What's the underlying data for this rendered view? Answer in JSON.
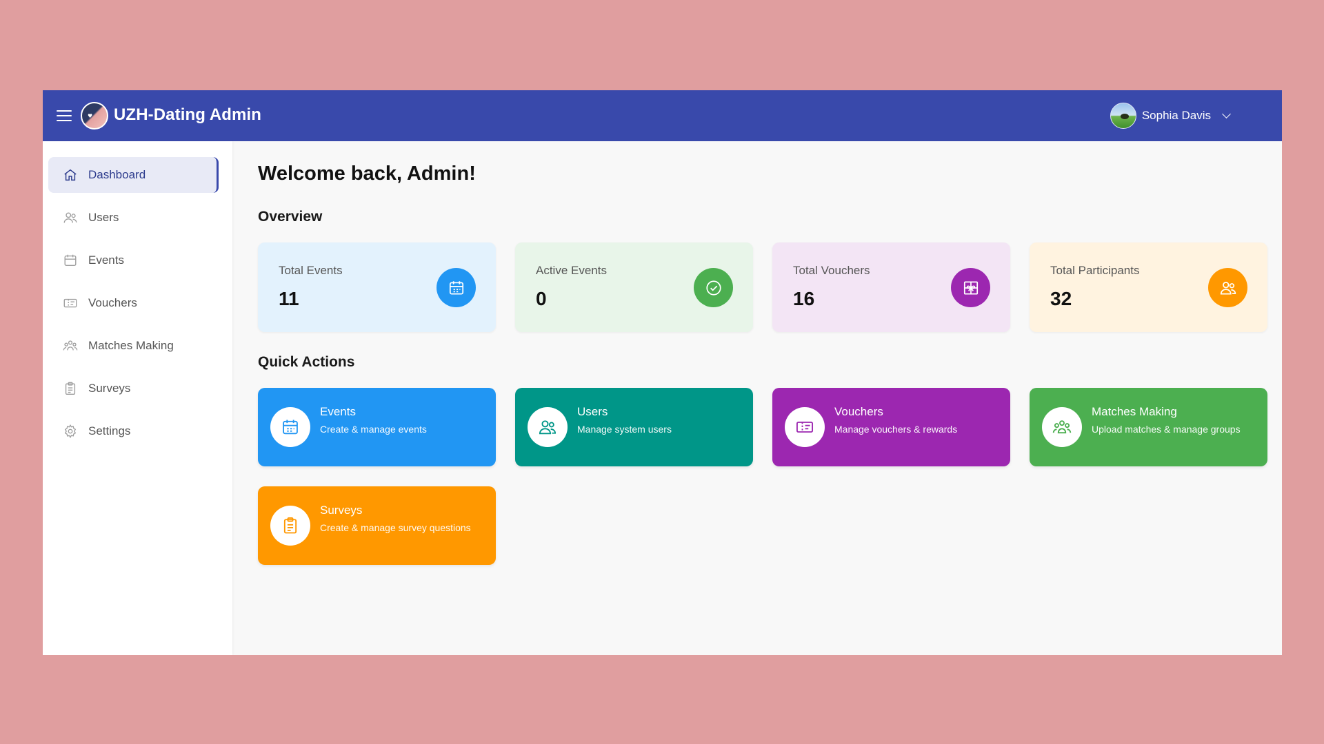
{
  "header": {
    "title": "UZH-Dating Admin",
    "user_name": "Sophia Davis",
    "bar_color": "#3949ab"
  },
  "sidebar": {
    "items": [
      {
        "label": "Dashboard",
        "icon": "home-icon",
        "active": true
      },
      {
        "label": "Users",
        "icon": "users-icon"
      },
      {
        "label": "Events",
        "icon": "calendar-icon"
      },
      {
        "label": "Vouchers",
        "icon": "ticket-icon"
      },
      {
        "label": "Matches Making",
        "icon": "group-icon"
      },
      {
        "label": "Surveys",
        "icon": "clipboard-icon"
      },
      {
        "label": "Settings",
        "icon": "gear-icon"
      }
    ]
  },
  "main": {
    "welcome": "Welcome back, Admin!",
    "overview_title": "Overview",
    "quick_actions_title": "Quick Actions",
    "stats": [
      {
        "label": "Total Events",
        "value": "11",
        "icon": "calendar-icon",
        "bg": "#e3f2fd",
        "color": "#2196f3"
      },
      {
        "label": "Active Events",
        "value": "0",
        "icon": "check-circle-icon",
        "bg": "#e8f5e9",
        "color": "#4caf50"
      },
      {
        "label": "Total Vouchers",
        "value": "16",
        "icon": "gift-icon",
        "bg": "#f3e5f5",
        "color": "#9c27b0"
      },
      {
        "label": "Total Participants",
        "value": "32",
        "icon": "users-icon",
        "bg": "#fff3e0",
        "color": "#ff9800"
      }
    ],
    "quick_actions": [
      {
        "title": "Events",
        "subtitle": "Create & manage events",
        "icon": "calendar-icon",
        "color": "#2196f3"
      },
      {
        "title": "Users",
        "subtitle": "Manage system users",
        "icon": "users-icon",
        "color": "#009688"
      },
      {
        "title": "Vouchers",
        "subtitle": "Manage vouchers & rewards",
        "icon": "ticket-icon",
        "color": "#9c27b0"
      },
      {
        "title": "Matches Making",
        "subtitle": "Upload matches & manage groups",
        "icon": "group-icon",
        "color": "#4caf50"
      },
      {
        "title": "Surveys",
        "subtitle": "Create & manage survey questions",
        "icon": "clipboard-icon",
        "color": "#ff9800"
      }
    ]
  }
}
